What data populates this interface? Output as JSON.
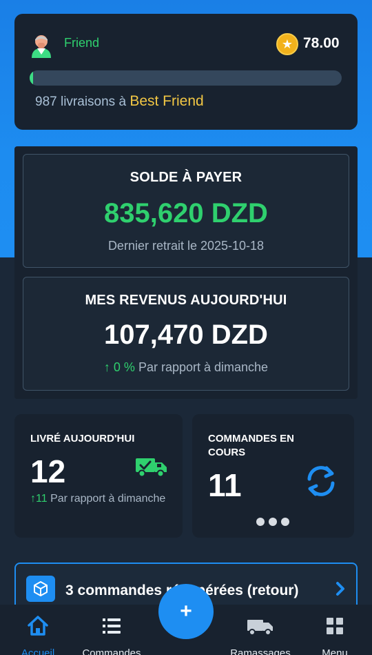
{
  "friend": {
    "level": "Friend",
    "coins": "78.00",
    "progress_fraction": 0.01,
    "progress_count": "987 livraisons à",
    "progress_target": "Best Friend"
  },
  "balance": {
    "title": "SOLDE À PAYER",
    "amount": "835,620 DZD",
    "last_withdrawal": "Dernier retrait le 2025-10-18"
  },
  "revenue": {
    "title": "MES REVENUS AUJOURD'HUI",
    "amount": "107,470 DZD",
    "change_arrow": "↑",
    "change_pct": "0 %",
    "compare_text": "Par rapport à dimanche"
  },
  "delivered": {
    "title": "LIVRÉ AUJOURD'HUI",
    "value": "12",
    "change": "↑11",
    "compare_text": "Par rapport à dimanche"
  },
  "in_progress": {
    "title": "COMMANDES EN COURS",
    "value": "11"
  },
  "returns_banner": {
    "text": "3  commandes récupérées (retour)"
  },
  "nav": {
    "home": "Accueil",
    "orders": "Commandes",
    "add": "+",
    "pickup": "Ramassages",
    "menu": "Menu"
  },
  "colors": {
    "accent": "#1e8ef2",
    "success": "#2fd06e",
    "gold": "#f2c744",
    "card": "#18222f"
  }
}
